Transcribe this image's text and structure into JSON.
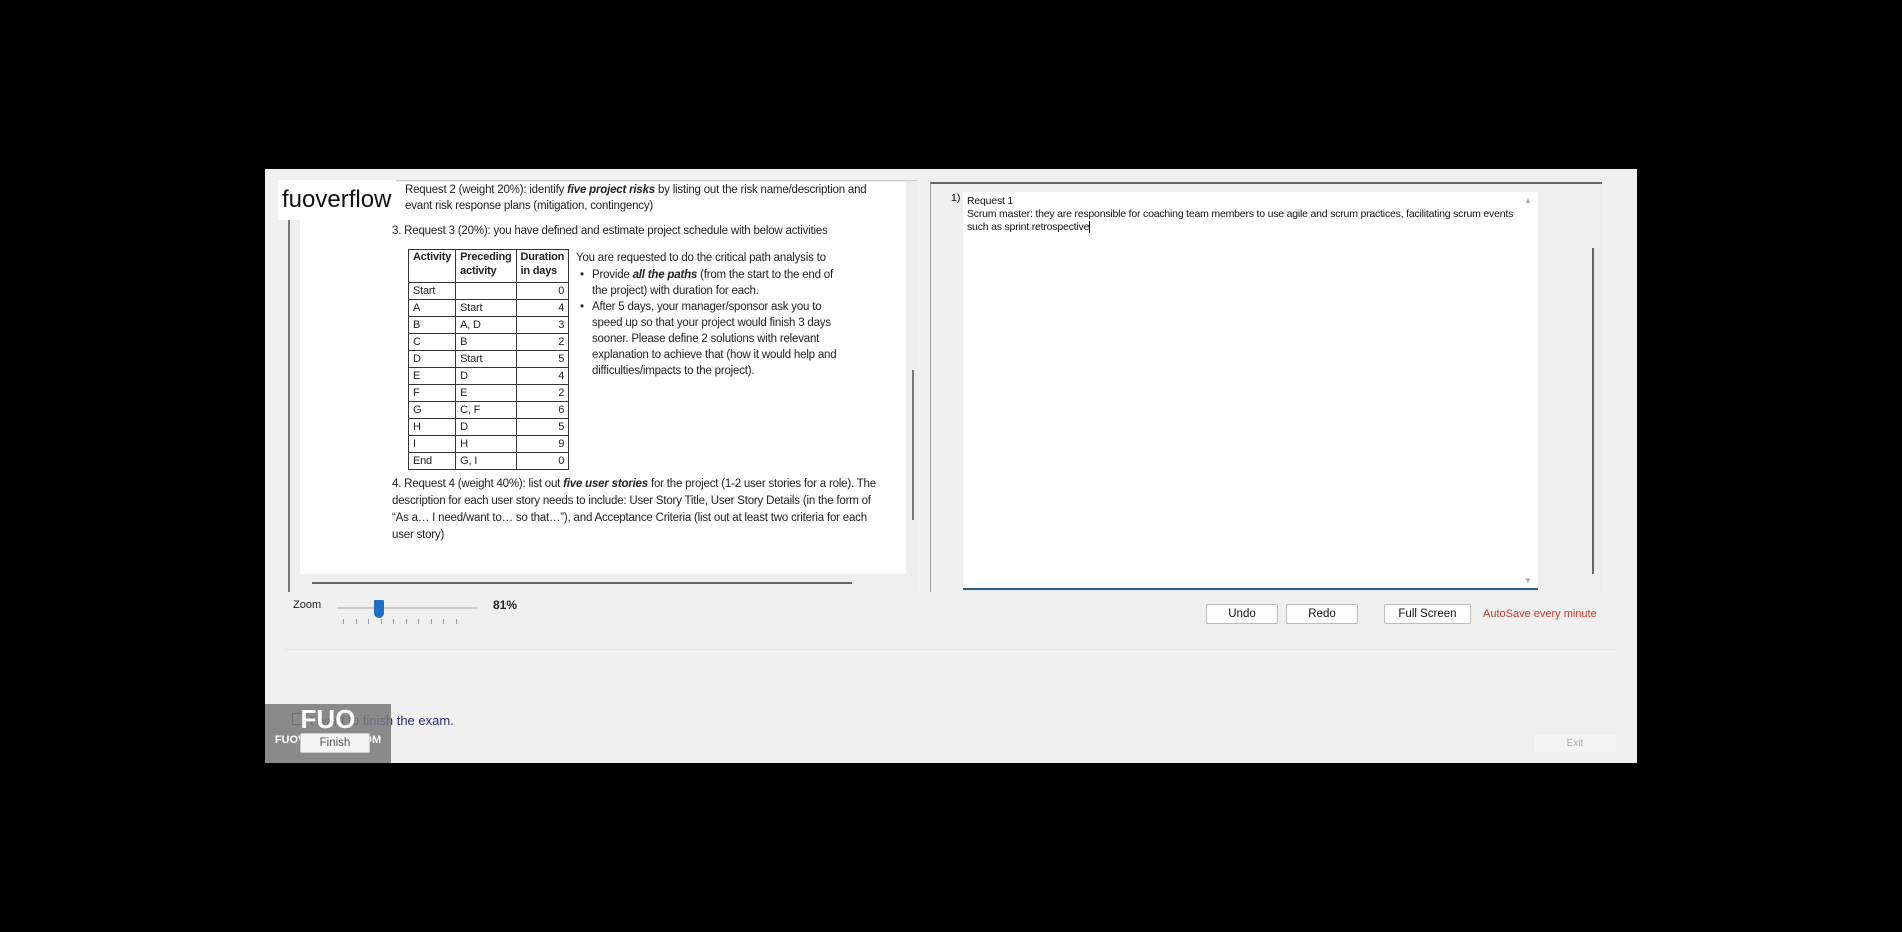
{
  "watermark": {
    "logo_text": "fuoverflow",
    "badge_text": "FUO",
    "badge_site": "FUOVERFLOW.COM"
  },
  "document": {
    "request2_line1_pre": "Request 2 (weight 20%): identify ",
    "request2_line1_bold": "five project risks",
    "request2_line1_post": " by listing out the risk name/description and",
    "request2_line2": "evant risk response plans (mitigation, contingency)",
    "request3_title": "3. Request 3 (20%): you have defined and estimate project schedule with below activities",
    "table": {
      "headers": [
        [
          "Activity",
          ""
        ],
        [
          "Preceding",
          "activity"
        ],
        [
          "Duration",
          "in days"
        ]
      ],
      "rows": [
        [
          "Start",
          "",
          "0"
        ],
        [
          "A",
          "Start",
          "4"
        ],
        [
          "B",
          "A, D",
          "3"
        ],
        [
          "C",
          "B",
          "2"
        ],
        [
          "D",
          "Start",
          "5"
        ],
        [
          "E",
          "D",
          "4"
        ],
        [
          "F",
          "E",
          "2"
        ],
        [
          "G",
          "C, F",
          "6"
        ],
        [
          "H",
          "D",
          "5"
        ],
        [
          "I",
          "H",
          "9"
        ],
        [
          "End",
          "G, I",
          "0"
        ]
      ]
    },
    "instructions_intro": "You are requested to do the critical path analysis to",
    "bullet1_pre": "Provide ",
    "bullet1_bold": "all the paths",
    "bullet1_post": " (from the start to the end of",
    "bullet1_line2": "the project) with duration for each.",
    "bullet2_lines": [
      "After 5 days, your manager/sponsor ask you to",
      "speed up so that your project would finish 3 days",
      "sooner. Please define 2 solutions with relevant",
      "explanation to achieve that (how it would help and",
      "difficulties/impacts to the project)."
    ],
    "request4_pre": "4. Request 4 (weight 40%): list out ",
    "request4_bold": "five user stories",
    "request4_post": " for the project (1-2 user stories for a role). The",
    "request4_lines": [
      "description for each user story needs to include: User Story Title, User Story Details (in the form of",
      "“As a… I need/want to… so that…”), and Acceptance Criteria (list out at least two criteria for each",
      "user story)"
    ]
  },
  "zoom": {
    "label": "Zoom",
    "value": "81%",
    "fraction": 0.3
  },
  "answer": {
    "number": "1)",
    "text": "Request 1\nScrum master: they are responsible for coaching team members to use agile and scrum practices, facilitating scrum events such as sprint retrospective"
  },
  "toolbar": {
    "undo": "Undo",
    "redo": "Redo",
    "fullscreen": "Full Screen",
    "autosave": "AutoSave every minute",
    "autosave_color": "#c0392b"
  },
  "footer": {
    "finish_checkbox_label": "I want to finish the exam.",
    "finish_button": "Finish",
    "exit_button": "Exit"
  }
}
